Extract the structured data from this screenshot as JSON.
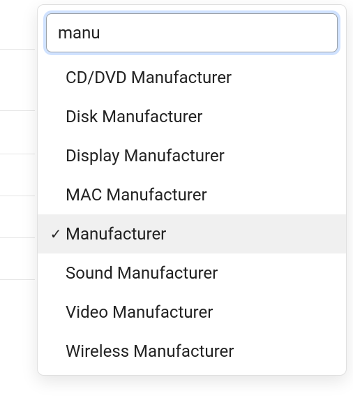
{
  "search": {
    "value": "manu",
    "placeholder": ""
  },
  "options": [
    {
      "label": "CD/DVD Manufacturer",
      "selected": false
    },
    {
      "label": "Disk Manufacturer",
      "selected": false
    },
    {
      "label": "Display Manufacturer",
      "selected": false
    },
    {
      "label": "MAC Manufacturer",
      "selected": false
    },
    {
      "label": "Manufacturer",
      "selected": true
    },
    {
      "label": "Sound Manufacturer",
      "selected": false
    },
    {
      "label": "Video Manufacturer",
      "selected": false
    },
    {
      "label": "Wireless Manufacturer",
      "selected": false
    }
  ]
}
